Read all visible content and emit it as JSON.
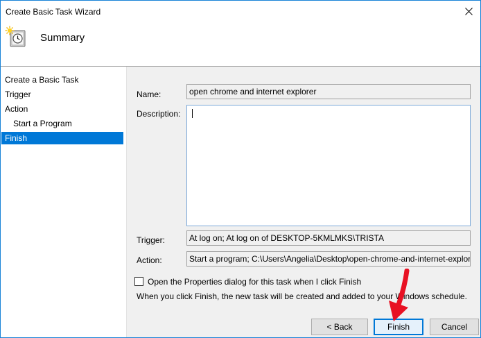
{
  "window": {
    "title": "Create Basic Task Wizard"
  },
  "header": {
    "title": "Summary",
    "icon": "scheduled-task-clock-icon"
  },
  "nav": {
    "items": [
      {
        "label": "Create a Basic Task",
        "active": false,
        "sub": false
      },
      {
        "label": "Trigger",
        "active": false,
        "sub": false
      },
      {
        "label": "Action",
        "active": false,
        "sub": false
      },
      {
        "label": "Start a Program",
        "active": false,
        "sub": true
      },
      {
        "label": "Finish",
        "active": true,
        "sub": false
      }
    ]
  },
  "form": {
    "name_label": "Name:",
    "name_value": "open chrome and internet explorer",
    "description_label": "Description:",
    "description_value": "",
    "trigger_label": "Trigger:",
    "trigger_value": "At log on; At log on of DESKTOP-5KMLMKS\\TRISTA",
    "action_label": "Action:",
    "action_value": "Start a program; C:\\Users\\Angelia\\Desktop\\open-chrome-and-internet-explorer.bat"
  },
  "options": {
    "open_properties_label": "Open the Properties dialog for this task when I click Finish",
    "open_properties_checked": false,
    "info_text": "When you click Finish, the new task will be created and added to your Windows schedule."
  },
  "buttons": {
    "back": "< Back",
    "finish": "Finish",
    "cancel": "Cancel"
  },
  "colors": {
    "accent": "#0078d7",
    "annotation_arrow": "#e81123"
  }
}
